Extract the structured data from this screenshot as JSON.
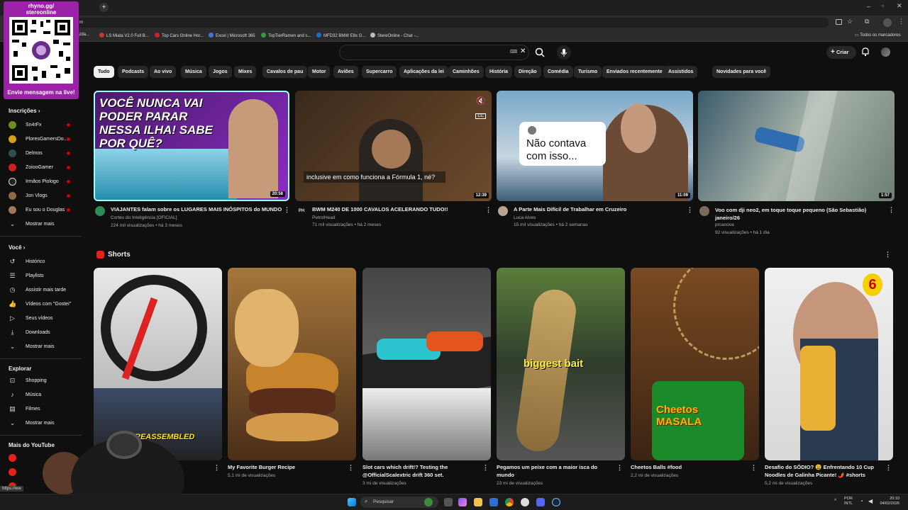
{
  "overlay": {
    "line1": "rhyno.gg/",
    "line2": "stereonline",
    "footer": "Envie mensagem na live!"
  },
  "browser": {
    "url": "m",
    "bookmarks": [
      {
        "label": "azda..."
      },
      {
        "label": "LS Miata V2.0 Full B..."
      },
      {
        "label": "Top Cars Online Hor..."
      },
      {
        "label": "Excel | Microsoft 365"
      },
      {
        "label": "TopTierRamen and s..."
      },
      {
        "label": "MFD32 BMW E8x G..."
      },
      {
        "label": "StereOnline - Chat -..."
      }
    ],
    "all_bookmarks": "Todos os marcadores"
  },
  "header": {
    "create_label": "Criar",
    "search_value": ""
  },
  "chips": [
    "Tudo",
    "Podcasts",
    "Ao vivo",
    "Música",
    "Jogos",
    "Mixes",
    "Cavalos de pau",
    "Motor",
    "Aviões",
    "Supercarro",
    "Aplicações da lei",
    "Caminhões",
    "História",
    "Direção",
    "Comédia",
    "Turismo",
    "Enviados recentemente",
    "Assistidos",
    "Novidades para você"
  ],
  "sidebar": {
    "subs_heading": "Inscrições",
    "subs": [
      "Sn4rFx",
      "PloresGamersDo...",
      "Delmos",
      "ZoiooGamer",
      "Irmãos Piologo",
      "Jon Vlogs",
      "Eu sou o Douglas"
    ],
    "show_more": "Mostrar mais",
    "you_heading": "Você",
    "you": [
      "Histórico",
      "Playlists",
      "Assistir mais tarde",
      "Vídeos com \"Gostei\"",
      "Seus vídeos",
      "Downloads"
    ],
    "show_more2": "Mostrar mais",
    "explore_heading": "Explorar",
    "explore": [
      "Shopping",
      "Música",
      "Filmes"
    ],
    "show_more3": "Mostrar mais",
    "more_heading": "Mais do YouTube"
  },
  "videos": [
    {
      "title": "VIAJANTES falam sobre os LUGARES MAIS INÓSPITOS do MUNDO",
      "channel": "Cortes do Inteligência [OFICIAL]",
      "meta": "224 mil visualizações • há 3 meses",
      "duration": "20:58",
      "thumb_text": "VOCÊ NUNCA VAI PODER PARAR NESSA ILHA! SABE POR QUÊ?"
    },
    {
      "title": "BWM M240 DE 1000 CAVALOS ACELERANDO TUDO!!",
      "channel": "PetrolHead",
      "meta": "71 mil visualizações • há 2 meses",
      "duration": "12:39",
      "thumb_text": "inclusive em como funciona a Fórmula 1, né?"
    },
    {
      "title": "A Parte Mais Difícil de Trabalhar em Cruzeiro",
      "channel": "Luca Alves",
      "meta": "15 mil visualizações • há 2 semanas",
      "duration": "11:09",
      "thumb_text": "Não contava com isso..."
    },
    {
      "title": "Voo com dji neo2, em toque toque pequeno (São Sebastião) janeiro/26",
      "channel": "prcanova",
      "meta": "92 visualizações • há 1 dia",
      "duration": "1:57",
      "thumb_text": ""
    }
  ],
  "shorts_heading": "Shorts",
  "shorts": [
    {
      "title": "",
      "views": "",
      "overlay": "REASSEMBLED"
    },
    {
      "title": "My Favorite Burger Recipe",
      "views": "5,1 mi de visualizações",
      "overlay": ""
    },
    {
      "title": "Slot cars which drift!? Testing the @OfficialScalextric drift 360 set.",
      "views": "3 mi de visualizações",
      "overlay": ""
    },
    {
      "title": "Pegamos um peixe com a maior isca do mundo",
      "views": "23 mi de visualizações",
      "overlay": "biggest bait"
    },
    {
      "title": "Cheetos Balls #food",
      "views": "2,2 mi de visualizações",
      "overlay": "Cheetos MASALA"
    },
    {
      "title": "Desafio do SÓDIO? 😩 Enfrentando 10 Cup Noodles de Galinha Picante! 🌶️ #shorts",
      "views": "5,2 mi de visualizações",
      "overlay": "6"
    }
  ],
  "taskbar": {
    "search_placeholder": "Pesquisar",
    "lang": "POR",
    "layout": "INTL",
    "time": "20:10",
    "date": "04/02/2026"
  },
  "status_url": "https://ww"
}
